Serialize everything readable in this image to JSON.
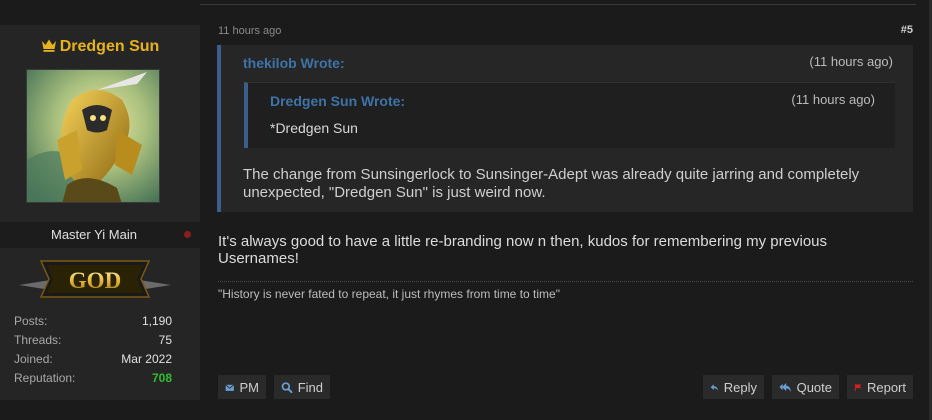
{
  "user": {
    "name": "Dredgen Sun",
    "title": "Master Yi Main",
    "rank_badge": "GOD",
    "stats": [
      {
        "label": "Posts:",
        "value": "1,190"
      },
      {
        "label": "Threads:",
        "value": "75"
      },
      {
        "label": "Joined:",
        "value": "Mar 2022"
      },
      {
        "label": "Reputation:",
        "value": "708"
      }
    ]
  },
  "post": {
    "time": "11 hours ago",
    "number": "#5",
    "quote": {
      "author": "thekilob Wrote:",
      "time": "(11 hours ago)",
      "nested": {
        "author": "Dredgen Sun Wrote:",
        "time": "(11 hours ago)",
        "text": "*Dredgen Sun"
      },
      "text": "The change from Sunsingerlock to Sunsinger-Adept was already quite jarring and completely unexpected, \"Dredgen Sun\" is just weird now."
    },
    "body": "It's always good to have a little re-branding now n then, kudos for remembering my previous Usernames!",
    "signature": "\"History is never fated to repeat, it just rhymes from time to time\""
  },
  "buttons": {
    "pm": "PM",
    "find": "Find",
    "reply": "Reply",
    "quote": "Quote",
    "report": "Report"
  },
  "colors": {
    "username": "#e8b21a",
    "quote_author": "#3e73a8",
    "reputation": "#2fbf2f",
    "report_icon": "#d42020",
    "button_icon": "#6a9fd4"
  }
}
